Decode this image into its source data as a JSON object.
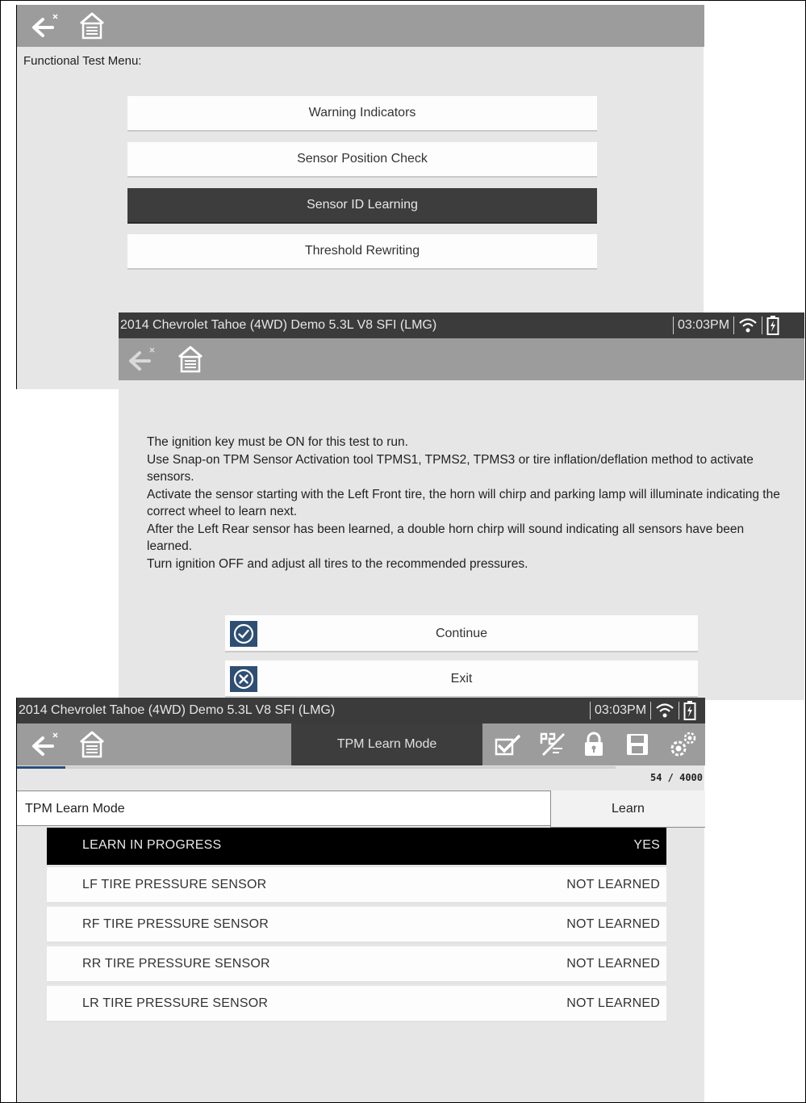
{
  "vehicle": "2014 Chevrolet Tahoe (4WD) Demo 5.3L V8 SFI (LMG)",
  "clock": "03:03PM",
  "icons": {
    "back": "back-arrow-icon",
    "home": "home-icon",
    "wifi": "wifi-icon",
    "battery": "battery-icon",
    "check": "checkmark-icon",
    "exit": "exit-icon",
    "scale": "scale-icon",
    "lock": "lock-icon",
    "save": "save-icon",
    "settings": "settings-icon"
  },
  "colors": {
    "toolbar": "#9c9c9c",
    "statusbar": "#3b3b3b",
    "selected": "#3d3d3d",
    "accent": "#2f4e73",
    "background": "#e6e6e6"
  },
  "menu": {
    "title": "Functional Test Menu:",
    "items": [
      {
        "label": "Warning Indicators"
      },
      {
        "label": "Sensor Position Check"
      },
      {
        "label": "Sensor ID Learning",
        "selected": true
      },
      {
        "label": "Threshold Rewriting"
      }
    ]
  },
  "instructions": {
    "lines": [
      "The ignition key must be ON for this test to run.",
      "Use Snap-on TPM Sensor Activation tool TPMS1, TPMS2, TPMS3 or tire inflation/deflation method to activate sensors.",
      "Activate the sensor starting with the Left Front tire, the horn will chirp and parking lamp will illuminate indicating the correct wheel to learn next.",
      "After the Left Rear sensor has been learned, a double horn chirp will sound indicating all sensors have been learned.",
      "Turn ignition OFF and adjust all tires to the recommended pressures."
    ],
    "continue_label": "Continue",
    "exit_label": "Exit"
  },
  "learn": {
    "tab_label": "TPM Learn Mode",
    "counter": "54 / 4000",
    "progress": 0.0135,
    "header_name": "TPM Learn Mode",
    "header_value": "Learn",
    "rows": [
      {
        "name": "LEARN IN PROGRESS",
        "value": "YES",
        "highlight": true
      },
      {
        "name": "LF TIRE PRESSURE SENSOR",
        "value": "NOT LEARNED"
      },
      {
        "name": "RF TIRE PRESSURE SENSOR",
        "value": "NOT LEARNED"
      },
      {
        "name": "RR TIRE PRESSURE SENSOR",
        "value": "NOT LEARNED"
      },
      {
        "name": "LR TIRE PRESSURE SENSOR",
        "value": "NOT LEARNED"
      }
    ]
  }
}
